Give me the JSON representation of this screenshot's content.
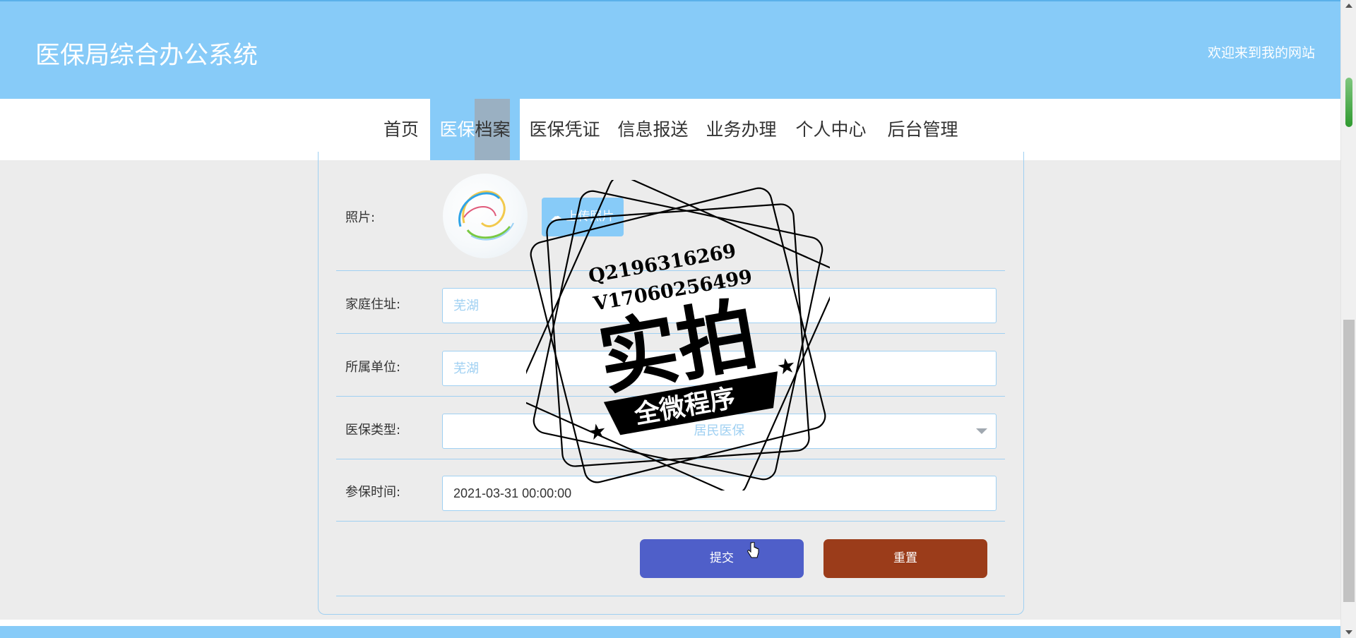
{
  "header": {
    "title": "医保局综合办公系统",
    "welcome": "欢迎来到我的网站"
  },
  "nav": {
    "items": [
      {
        "label": "首页"
      },
      {
        "label_a": "医保",
        "label_b": "档案"
      },
      {
        "label": "医保凭证"
      },
      {
        "label": "信息报送"
      },
      {
        "label": "业务办理"
      },
      {
        "label": "个人中心"
      },
      {
        "label": "后台管理"
      }
    ]
  },
  "form": {
    "photo_label": "照片:",
    "upload_label": "上传照片",
    "address_label": "家庭住址:",
    "address_value": "芜湖",
    "unit_label": "所属单位:",
    "unit_value": "芜湖",
    "type_label": "医保类型:",
    "type_value": "居民医保",
    "time_label": "参保时间:",
    "time_value": "2021-03-31 00:00:00",
    "submit_label": "提交",
    "reset_label": "重置"
  },
  "watermark": {
    "line1": "Q2196316269",
    "line2": "V17060256499",
    "main": "实拍",
    "banner": "全微程序"
  }
}
